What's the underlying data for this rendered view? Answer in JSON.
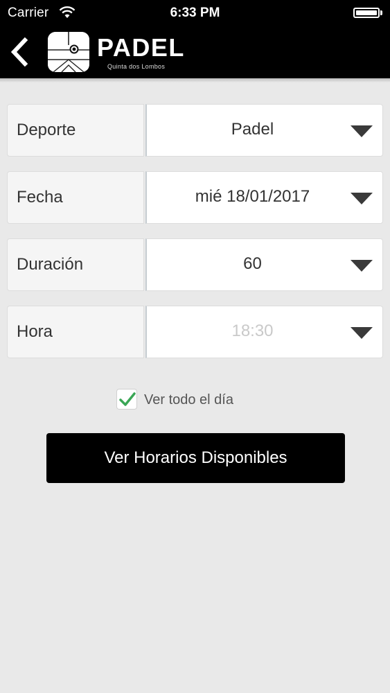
{
  "status_bar": {
    "carrier": "Carrier",
    "time": "6:33 PM",
    "wifi_icon": "wifi-icon",
    "battery_icon": "battery-icon"
  },
  "header": {
    "back_icon": "chevron-left-icon",
    "logo_icon": "padel-court-logo",
    "brand": "PADEL",
    "subtitle": "Quinta dos Lombos",
    "background_color": "#000000"
  },
  "form": {
    "fields": [
      {
        "label": "Deporte",
        "value": "Padel",
        "disabled": false
      },
      {
        "label": "Fecha",
        "value": "mié 18/01/2017",
        "disabled": false
      },
      {
        "label": "Duración",
        "value": "60",
        "disabled": false
      },
      {
        "label": "Hora",
        "value": "18:30",
        "disabled": true
      }
    ],
    "dropdown_icon": "caret-down-icon",
    "show_all_day": {
      "label": "Ver todo el día",
      "checked": true,
      "check_color": "#3aa655"
    },
    "submit_label": "Ver Horarios Disponibles"
  },
  "colors": {
    "background": "#e9e9e9",
    "button": "#000000",
    "disabled_text": "#c9c9c9"
  }
}
